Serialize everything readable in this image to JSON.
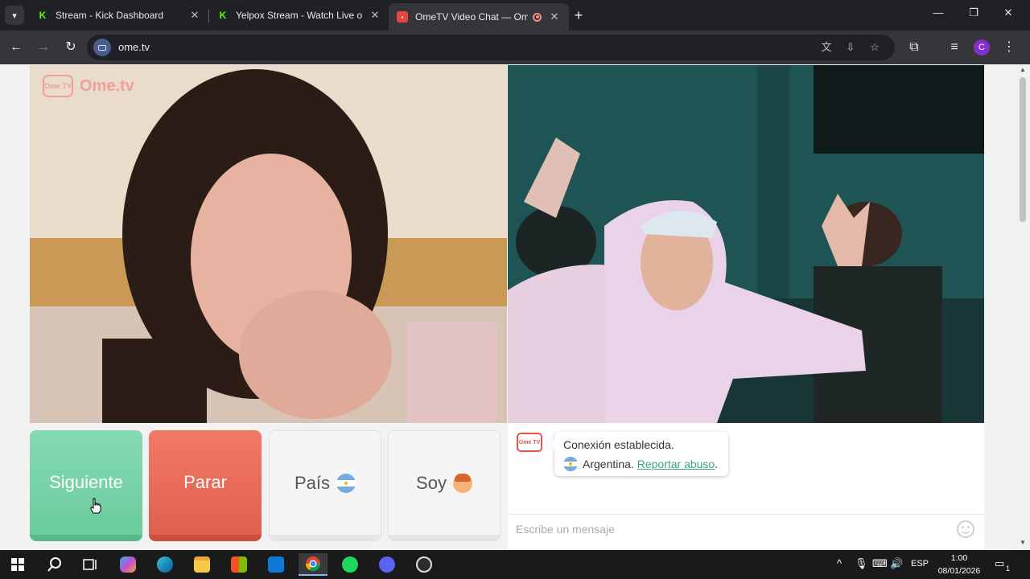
{
  "browser": {
    "tabs": [
      {
        "title": "Stream - Kick Dashboard",
        "favicon": "kick-icon",
        "active": false
      },
      {
        "title": "Yelpox Stream - Watch Live on K",
        "favicon": "kick-icon",
        "active": false
      },
      {
        "title": "OmeTV Video Chat — Ome",
        "favicon": "ometv-icon",
        "active": true,
        "recording": true
      }
    ],
    "url": "ome.tv",
    "profile_initial": "C"
  },
  "page": {
    "brand_badge": "Ome TV",
    "brand_name": "Ome.tv",
    "buttons": {
      "next": "Siguiente",
      "stop": "Parar",
      "country": "País",
      "gender": "Soy"
    },
    "chat": {
      "logo": "Ome TV",
      "status": "Conexión establecida.",
      "country": "Argentina.",
      "report_link": "Reportar abuso",
      "report_suffix": ".",
      "input_placeholder": "Escribe un mensaje"
    },
    "colors": {
      "next": "#6acb9c",
      "stop": "#e0604d",
      "link": "#3fa57d"
    }
  },
  "taskbar": {
    "language": "ESP",
    "time": "1:00",
    "date": "08/01/2026",
    "notification_count": "1"
  }
}
